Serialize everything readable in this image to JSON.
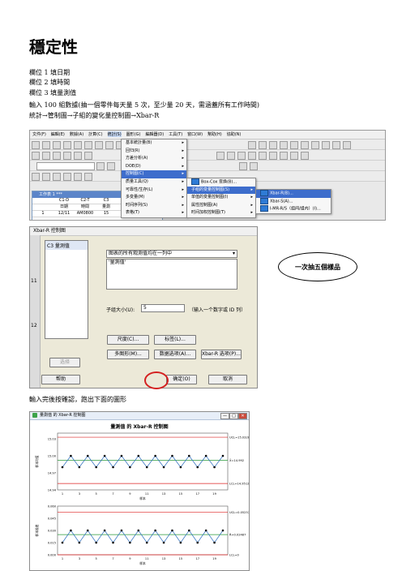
{
  "doc": {
    "title": "穩定性",
    "lines": [
      "欄位 1 填日期",
      "欄位 2 填時間",
      "欄位 3 填量測值",
      "輸入 100 組數據(抽一個零件每天量 5 次，至少量 20 天，需涵蓋所有工作時間)",
      "統計→管制圖→子組的變化量控制圖→Xbar-R"
    ],
    "after_dialog": "輸入完後按確認，跑出下面的圖形"
  },
  "minitab": {
    "menubar": [
      "文件(F)",
      "編輯(E)",
      "數據(A)",
      "計算(C)",
      "統計(S)",
      "圖形(G)",
      "編輯器(D)",
      "工具(T)",
      "窗口(W)",
      "幫助(H)",
      "協助(N)"
    ],
    "worksheet_title": "工作表 1 ***",
    "worksheet_header": [
      "",
      "C1-D",
      "C2-T",
      "C3"
    ],
    "worksheet_sub": [
      "",
      "日期",
      "時間",
      "量測"
    ],
    "worksheet_row": [
      "1",
      "12/11",
      "AM0800",
      "15"
    ],
    "stat_menu": [
      "基本統計量(B)",
      "回归(R)",
      "方差分析(A)",
      "DOE(D)",
      "控制图(C)",
      "质量工具(Q)",
      "可靠性/生存(L)",
      "多变量(M)",
      "时间序列(S)",
      "表格(T)"
    ],
    "control_chart_menu": [
      "Box-Cox 变换(B)...",
      "子组的变量控制图(S)",
      "单值的变量控制图(I)",
      "属性控制图(A)",
      "时间加权控制图(T)"
    ],
    "subgroup_menu": [
      "Xbar-R(B)...",
      "Xbar-S(A)...",
      "I-MR-R/S（组间/组内）(I)..."
    ]
  },
  "dialog": {
    "title": "Xbar-R 控制图",
    "left_numbers": [
      "11",
      "12"
    ],
    "list_items": [
      "C3    量測值"
    ],
    "mode_select": "图表的所有观测值均在一列中",
    "variables_value": "'量測值'",
    "subgroup_label": "子组大小(U):",
    "subgroup_value": "5",
    "subgroup_hint": "（输入一个数字或 ID 列）",
    "buttons": {
      "scale": "尺度(C)...",
      "labels": "标签(L)...",
      "multiple": "多图形(M)...",
      "data_options": "数据选项(A)...",
      "xbar_options": "Xbar-R 选项(P)...",
      "select": "选择",
      "help": "帮助",
      "ok": "确定(O)",
      "cancel": "取消"
    },
    "callout": "一次抽五個樣品"
  },
  "chart_window": {
    "title": "量測值 的 Xbar-R 控制图",
    "controls": [
      "—",
      "□",
      "✕"
    ]
  },
  "chart_data": [
    {
      "type": "line",
      "title": "量測值 的 Xbar-R 控制图",
      "ylabel": "样本均值",
      "xlabel": "样本",
      "x": [
        1,
        2,
        3,
        4,
        5,
        6,
        7,
        8,
        9,
        10,
        11,
        12,
        13,
        14,
        15,
        16,
        17,
        18,
        19,
        20
      ],
      "x_ticks": [
        1,
        3,
        5,
        7,
        9,
        11,
        13,
        15,
        17,
        19
      ],
      "y_ticks": [
        "15.03",
        "15.00",
        "14.97",
        "14.94"
      ],
      "ylim": [
        14.94,
        15.04
      ],
      "values": [
        14.98,
        15.0,
        14.98,
        15.0,
        14.98,
        15.0,
        14.98,
        15.0,
        14.98,
        15.0,
        14.98,
        15.0,
        14.98,
        15.0,
        14.98,
        15.0,
        14.98,
        15.0,
        14.98,
        15.0
      ],
      "ucl": 15.0328,
      "center": 14.992,
      "lcl": 14.9512,
      "limit_labels": [
        "UCL=15.0328",
        "X̄=14.992",
        "LCL=14.9512"
      ]
    },
    {
      "type": "line",
      "ylabel": "样本极差",
      "xlabel": "样本",
      "x": [
        1,
        2,
        3,
        4,
        5,
        6,
        7,
        8,
        9,
        10,
        11,
        12,
        13,
        14,
        15,
        16,
        17,
        18,
        19,
        20
      ],
      "x_ticks": [
        1,
        3,
        5,
        7,
        9,
        11,
        13,
        15,
        17,
        19
      ],
      "y_ticks": [
        "0.060",
        "0.045",
        "0.030",
        "0.015",
        "0.000"
      ],
      "ylim": [
        0,
        0.06
      ],
      "values": [
        0.015,
        0.03,
        0.015,
        0.03,
        0.015,
        0.03,
        0.015,
        0.03,
        0.015,
        0.03,
        0.015,
        0.03,
        0.015,
        0.03,
        0.015,
        0.03,
        0.015,
        0.03,
        0.015,
        0.03
      ],
      "ucl": 0.05257,
      "center": 0.02487,
      "lcl": 0,
      "limit_labels": [
        "UCL=0.05257",
        "R̄=0.02487",
        "LCL=0"
      ]
    }
  ]
}
